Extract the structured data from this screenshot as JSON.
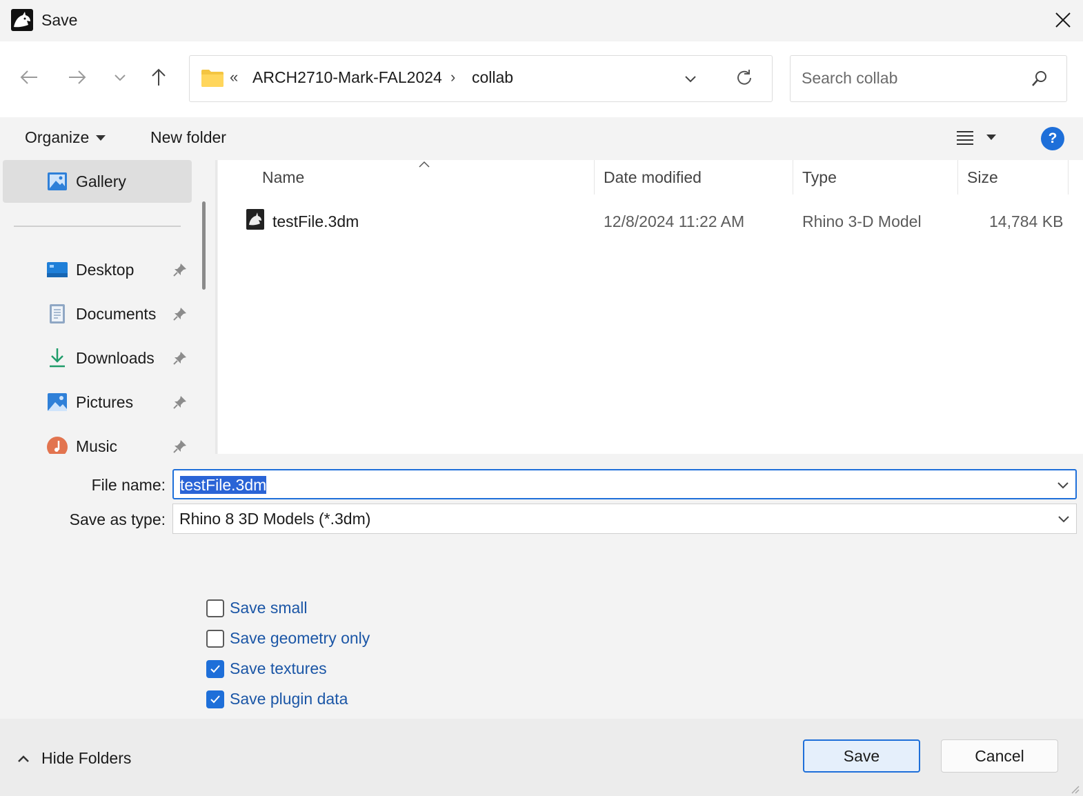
{
  "window": {
    "title": "Save",
    "app_icon": "rhino-icon",
    "close_icon": "close-icon"
  },
  "nav": {
    "back_icon": "arrow-left-icon",
    "forward_icon": "arrow-right-icon",
    "recent_icon": "chevron-down-icon",
    "up_icon": "arrow-up-icon",
    "breadcrumb": {
      "overflow": "«",
      "parent": "ARCH2710-Mark-FAL2024",
      "separator": "›",
      "current": "collab"
    },
    "search_placeholder": "Search collab"
  },
  "toolbar": {
    "organize": "Organize",
    "new_folder": "New folder",
    "help": "?"
  },
  "sidebar": {
    "items": [
      {
        "label": "Gallery",
        "icon": "gallery-icon",
        "selected": true,
        "pinned": false
      },
      {
        "label": "Desktop",
        "icon": "desktop-icon",
        "pinned": true
      },
      {
        "label": "Documents",
        "icon": "documents-icon",
        "pinned": true
      },
      {
        "label": "Downloads",
        "icon": "downloads-icon",
        "pinned": true
      },
      {
        "label": "Pictures",
        "icon": "pictures-icon",
        "pinned": true
      },
      {
        "label": "Music",
        "icon": "music-icon",
        "pinned": true
      }
    ]
  },
  "filelist": {
    "columns": [
      "Name",
      "Date modified",
      "Type",
      "Size"
    ],
    "rows": [
      {
        "name": "testFile.3dm",
        "date": "12/8/2024 11:22 AM",
        "type": "Rhino 3-D Model",
        "size": "14,784 KB",
        "icon": "rhino-file-icon"
      }
    ]
  },
  "form": {
    "file_name_label": "File name:",
    "file_name_value": "testFile.3dm",
    "save_type_label": "Save as type:",
    "save_type_value": "Rhino 8 3D Models (*.3dm)"
  },
  "options": [
    {
      "label": "Save small",
      "checked": false
    },
    {
      "label": "Save geometry only",
      "checked": false
    },
    {
      "label": "Save textures",
      "checked": true
    },
    {
      "label": "Save plugin data",
      "checked": true
    }
  ],
  "footer": {
    "hide_folders": "Hide Folders",
    "save": "Save",
    "cancel": "Cancel"
  },
  "colors": {
    "accent": "#1e6fd9",
    "selection": "#2a64d6",
    "option_text": "#1b56a6"
  }
}
